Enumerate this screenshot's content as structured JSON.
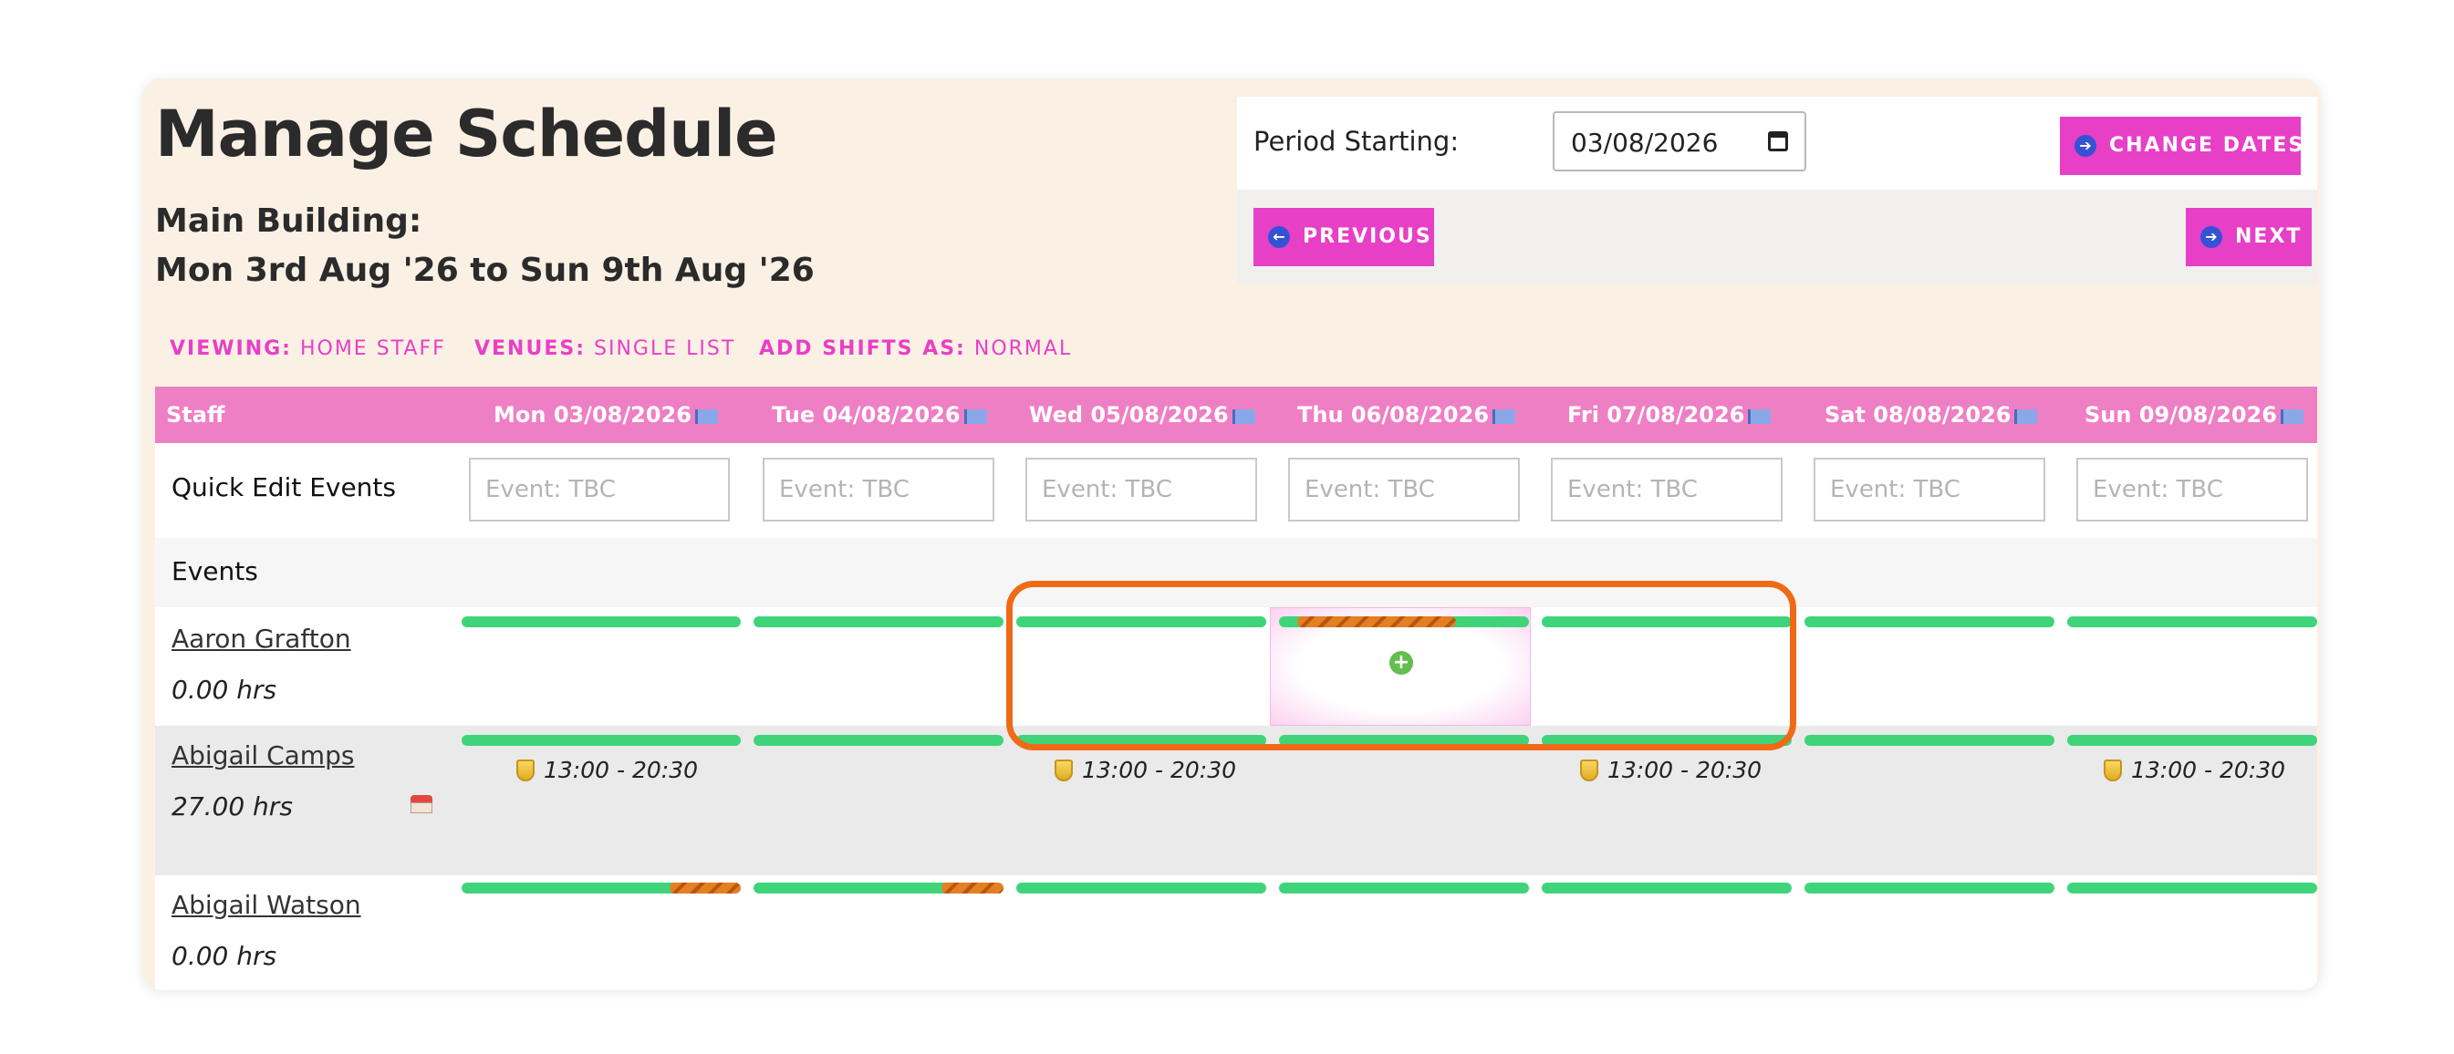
{
  "header": {
    "title": "Manage Schedule",
    "building": "Main Building:",
    "date_range": "Mon 3rd Aug '26 to Sun 9th Aug '26"
  },
  "period": {
    "label": "Period Starting:",
    "date_value": "03/08/2026",
    "change_dates_label": "CHANGE DATES",
    "previous_label": "PREVIOUS",
    "next_label": "NEXT"
  },
  "filters": {
    "viewing_key": "VIEWING:",
    "viewing_value": "HOME STAFF",
    "venues_key": "VENUES:",
    "venues_value": "SINGLE LIST",
    "add_shifts_key": "ADD SHIFTS AS:",
    "add_shifts_value": "NORMAL"
  },
  "table": {
    "staff_header": "Staff",
    "days": [
      "Mon 03/08/2026",
      "Tue 04/08/2026",
      "Wed 05/08/2026",
      "Thu 06/08/2026",
      "Fri 07/08/2026",
      "Sat 08/08/2026",
      "Sun 09/08/2026"
    ],
    "quick_edit_label": "Quick Edit Events",
    "event_placeholder": "Event: TBC",
    "events_label": "Events",
    "staff": [
      {
        "name": "Aaron Grafton",
        "hours": "0.00 hrs"
      },
      {
        "name": "Abigail Camps",
        "hours": "27.00 hrs",
        "shift_time": "13:00 - 20:30"
      },
      {
        "name": "Abigail Watson",
        "hours": "0.00 hrs"
      }
    ]
  },
  "colors": {
    "accent": "#e83fc7",
    "header_bg": "#ef7fc4",
    "available_bar": "#3fd47a",
    "unavailable_hatch": "#e67e22",
    "highlight_outline": "#ef6a17",
    "card_bg": "#faf0e4"
  }
}
